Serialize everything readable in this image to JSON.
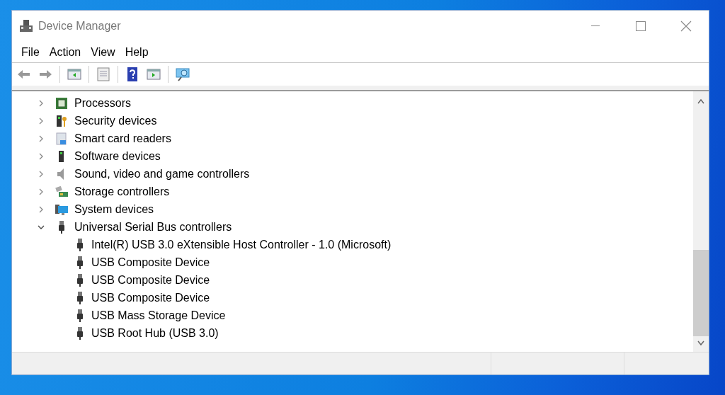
{
  "window": {
    "title": "Device Manager"
  },
  "menu": [
    "File",
    "Action",
    "View",
    "Help"
  ],
  "tree": [
    {
      "label": "Processors",
      "kind": "processor",
      "expanded": false
    },
    {
      "label": "Security devices",
      "kind": "security",
      "expanded": false
    },
    {
      "label": "Smart card readers",
      "kind": "smartcard",
      "expanded": false
    },
    {
      "label": "Software devices",
      "kind": "software",
      "expanded": false
    },
    {
      "label": "Sound, video and game controllers",
      "kind": "sound",
      "expanded": false
    },
    {
      "label": "Storage controllers",
      "kind": "storage",
      "expanded": false
    },
    {
      "label": "System devices",
      "kind": "system",
      "expanded": false
    },
    {
      "label": "Universal Serial Bus controllers",
      "kind": "usb",
      "expanded": true,
      "children": [
        {
          "label": "Intel(R) USB 3.0 eXtensible Host Controller - 1.0 (Microsoft)",
          "kind": "usb"
        },
        {
          "label": "USB Composite Device",
          "kind": "usb"
        },
        {
          "label": "USB Composite Device",
          "kind": "usb"
        },
        {
          "label": "USB Composite Device",
          "kind": "usb"
        },
        {
          "label": "USB Mass Storage Device",
          "kind": "usb"
        },
        {
          "label": "USB Root Hub (USB 3.0)",
          "kind": "usb"
        }
      ]
    }
  ]
}
